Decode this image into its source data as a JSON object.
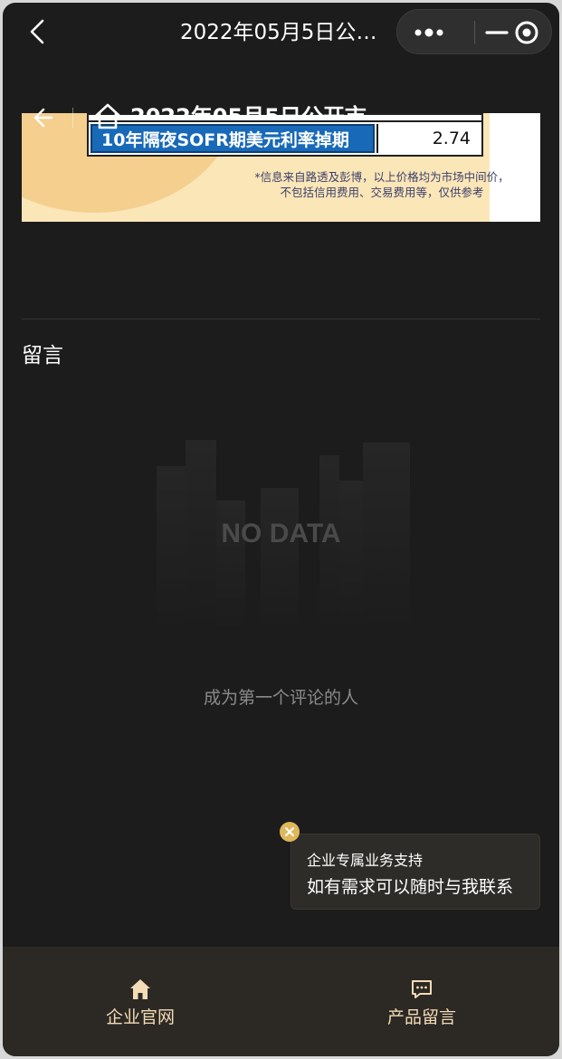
{
  "topbar": {
    "title": "2022年05月5日公开…",
    "back_icon": "chevron-left-icon",
    "capsule_icons": [
      "more-dots-icon",
      "minimize-icon",
      "target-icon"
    ]
  },
  "webview": {
    "title": "2022年05月5日公开市",
    "banner": {
      "row_label": "10年隔夜SOFR期美元利率掉期",
      "row_value": "2.74",
      "note_line1": "*信息来自路透及彭博，以上价格均为市场中间价，",
      "note_line2": "不包括信用费用、交易费用等，仅供参考"
    }
  },
  "comments": {
    "section_title": "留言",
    "empty_image_text": "NO DATA",
    "empty_hint": "成为第一个评论的人"
  },
  "support_popup": {
    "line1": "企业专属业务支持",
    "line2": "如有需求可以随时与我联系"
  },
  "tabbar": {
    "items": [
      {
        "label": "企业官网",
        "icon": "home-icon"
      },
      {
        "label": "产品留言",
        "icon": "chat-icon"
      }
    ]
  },
  "colors": {
    "background": "#1c1c1c",
    "tabbar": "#2c2925",
    "tab_text": "#f3dcb6",
    "accent_close": "#e0b75a",
    "table_blue": "#1869b8"
  }
}
